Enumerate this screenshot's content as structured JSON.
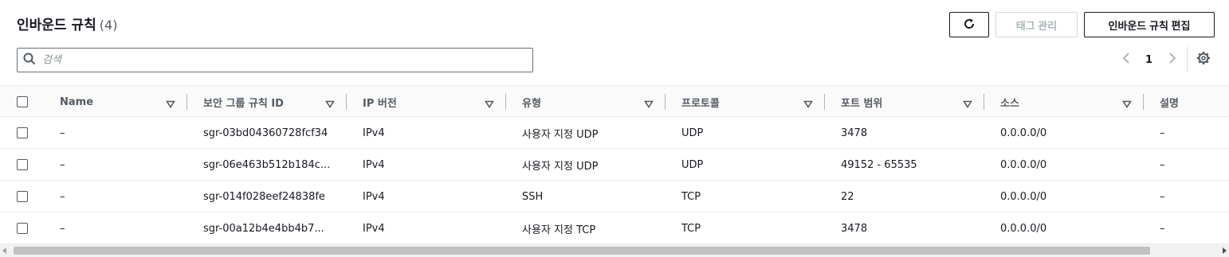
{
  "header": {
    "title": "인바운드 규칙",
    "count": "(4)"
  },
  "toolbar": {
    "refresh_icon": "refresh-icon",
    "tags_label": "태그 관리",
    "edit_label": "인바운드 규칙 편집"
  },
  "search": {
    "placeholder": "검색",
    "value": ""
  },
  "pagination": {
    "current_page": "1",
    "prev_icon": "chevron-left-icon",
    "next_icon": "chevron-right-icon",
    "settings_icon": "gear-icon"
  },
  "table": {
    "columns": [
      "Name",
      "보안 그룹 규칙 ID",
      "IP 버전",
      "유형",
      "프로토콜",
      "포트 범위",
      "소스",
      "설명"
    ],
    "rows": [
      {
        "name": "–",
        "rule_id": "sgr-03bd04360728fcf34",
        "ip_version": "IPv4",
        "type": "사용자 지정 UDP",
        "protocol": "UDP",
        "port_range": "3478",
        "source": "0.0.0.0/0",
        "description": "–"
      },
      {
        "name": "–",
        "rule_id": "sgr-06e463b512b184c...",
        "ip_version": "IPv4",
        "type": "사용자 지정 UDP",
        "protocol": "UDP",
        "port_range": "49152 - 65535",
        "source": "0.0.0.0/0",
        "description": "–"
      },
      {
        "name": "–",
        "rule_id": "sgr-014f028eef24838fe",
        "ip_version": "IPv4",
        "type": "SSH",
        "protocol": "TCP",
        "port_range": "22",
        "source": "0.0.0.0/0",
        "description": "–"
      },
      {
        "name": "–",
        "rule_id": "sgr-00a12b4e4bb4b7...",
        "ip_version": "IPv4",
        "type": "사용자 지정 TCP",
        "protocol": "TCP",
        "port_range": "3478",
        "source": "0.0.0.0/0",
        "description": "–"
      }
    ]
  },
  "colors": {
    "text": "#16191f",
    "muted": "#545b64",
    "border": "#eaeded",
    "disabled": "#aab7b8"
  }
}
